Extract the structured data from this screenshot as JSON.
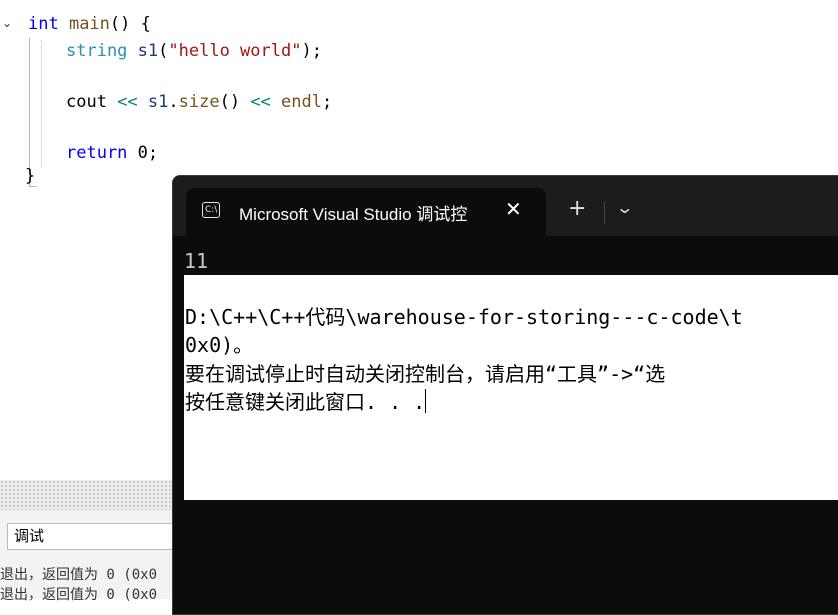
{
  "editor": {
    "fold_glyph": "⌄",
    "lines": [
      {
        "text_a": "int",
        "text_b": " main",
        "text_c": "() {"
      },
      {
        "type": "string",
        "name": " s1",
        "open": "(",
        "literal": "\"hello world\"",
        "close": ");"
      },
      {
        "cout": "cout",
        "op1": " << ",
        "s1": "s1",
        "dot": ".",
        "size": "size",
        "parens": "()",
        "op2": " << ",
        "endl": "endl",
        "semi": ";"
      },
      {
        "ret": "return",
        "val": " 0;"
      },
      {
        "brace": "}"
      }
    ]
  },
  "output_pane": {
    "source_value": "调试",
    "lines": [
      "退出，返回值为 0 (0x0",
      "退出，返回值为 0 (0x0"
    ]
  },
  "terminal": {
    "tab_title": "Microsoft Visual Studio 调试控",
    "tab_icon_glyph": "C:\\",
    "close_glyph": "✕",
    "new_tab_glyph": "+",
    "dropdown_glyph": "⌄",
    "program_output": "11",
    "path_line": "D:\\C++\\C++代码\\warehouse-for-storing---c-code\\t",
    "exit_line": "0x0)。",
    "hint_line": "要在调试停止时自动关闭控制台，请启用“工具”->“选",
    "press_key_line": "按任意键关闭此窗口. . ."
  }
}
